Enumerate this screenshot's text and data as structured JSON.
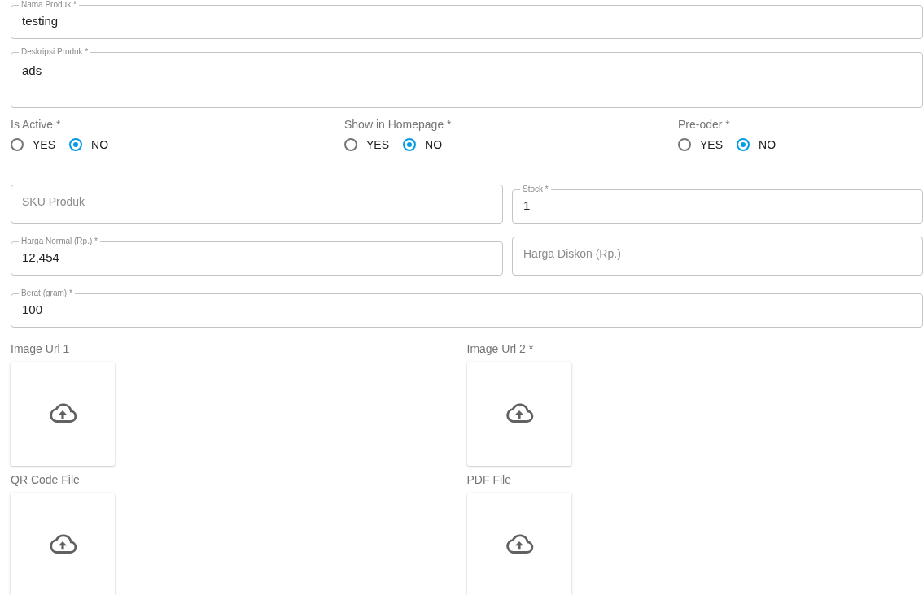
{
  "fields_top": [
    {
      "kind": "input",
      "label": "Nama Produk *",
      "value": "testing"
    },
    {
      "kind": "textarea",
      "label": "Deskripsi Produk *",
      "value": "ads"
    }
  ],
  "radio_groups": [
    {
      "label": "Is Active *",
      "options": [
        {
          "label": "YES",
          "selected": false
        },
        {
          "label": "NO",
          "selected": true
        }
      ]
    },
    {
      "label": "Show in Homepage *",
      "options": [
        {
          "label": "YES",
          "selected": false
        },
        {
          "label": "NO",
          "selected": true
        }
      ]
    },
    {
      "label": "Pre-oder *",
      "options": [
        {
          "label": "YES",
          "selected": false
        },
        {
          "label": "NO",
          "selected": true
        }
      ]
    }
  ],
  "field_rows": [
    [
      {
        "kind": "input",
        "placeholder": "SKU Produk"
      },
      {
        "kind": "input",
        "label": "Stock *",
        "value": "1"
      }
    ],
    [
      {
        "kind": "input",
        "label": "Harga Normal (Rp.) *",
        "value": "12,454"
      },
      {
        "kind": "input",
        "placeholder": "Harga Diskon (Rp.)"
      }
    ],
    [
      {
        "kind": "input",
        "label": "Berat (gram) *",
        "value": "100"
      }
    ]
  ],
  "uploads": [
    [
      {
        "label": "Image Url 1"
      },
      {
        "label": "Image Url 2 *"
      }
    ],
    [
      {
        "label": "QR Code File"
      },
      {
        "label": "PDF File"
      }
    ]
  ]
}
